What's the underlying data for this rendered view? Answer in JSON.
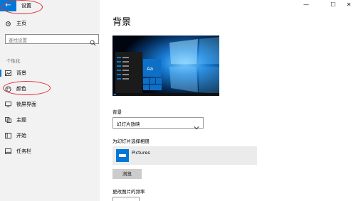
{
  "app": {
    "title": "设置",
    "back_icon": "back-arrow-icon"
  },
  "window": {
    "minimize": "—",
    "maximize": "☐",
    "close": "✕"
  },
  "sidebar": {
    "home": "主页",
    "search_placeholder": "查找设置",
    "section": "个性化",
    "items": [
      {
        "label": "背景",
        "icon": "image-icon",
        "active": true
      },
      {
        "label": "颜色",
        "icon": "palette-icon",
        "active": false
      },
      {
        "label": "锁屏界面",
        "icon": "lock-screen-icon",
        "active": false
      },
      {
        "label": "主题",
        "icon": "theme-icon",
        "active": false
      },
      {
        "label": "开始",
        "icon": "start-icon",
        "active": false
      },
      {
        "label": "任务栏",
        "icon": "taskbar-icon",
        "active": false
      }
    ]
  },
  "main": {
    "title": "背景",
    "preview": {
      "tile_text": "Aa"
    },
    "background_label": "背景",
    "background_value": "幻灯片放映",
    "album_label": "为幻灯片选择相册",
    "album_name": "Pictures",
    "browse_label": "浏览",
    "frequency_label": "更改图片的频率"
  },
  "colors": {
    "accent": "#0078d7",
    "sidebar_bg": "#f2f2f2",
    "annotation": "#e0303a"
  }
}
